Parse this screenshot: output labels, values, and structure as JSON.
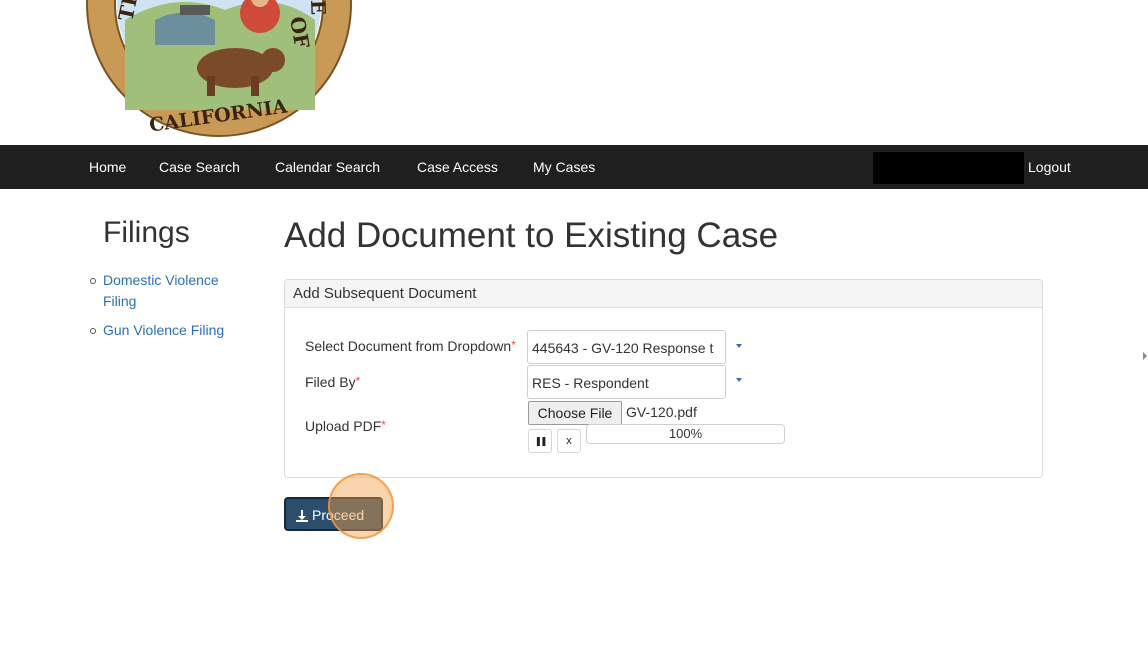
{
  "seal": {
    "text_left": "THE",
    "text_bottom": "CALIFORNIA",
    "text_right": "OF",
    "text_top_right": "E"
  },
  "nav": {
    "items": [
      {
        "label": "Home"
      },
      {
        "label": "Case Search"
      },
      {
        "label": "Calendar Search"
      },
      {
        "label": "Case Access"
      },
      {
        "label": "My Cases"
      }
    ],
    "logout_label": "Logout"
  },
  "sidebar": {
    "title": "Filings",
    "items": [
      {
        "label": "Domestic Violence Filing"
      },
      {
        "label": "Gun Violence Filing"
      }
    ]
  },
  "main": {
    "title": "Add Document to Existing Case",
    "panel_title": "Add Subsequent Document",
    "form": {
      "document_label": "Select Document from Dropdown",
      "document_value": "445643 - GV-120 Response t",
      "filed_by_label": "Filed By",
      "filed_by_value": "RES - Respondent",
      "upload_label": "Upload PDF",
      "required_mark": "*",
      "choose_file_label": "Choose File",
      "file_name": "GV-120.pdf",
      "pause_symbol": "❚❚",
      "cancel_symbol": "x",
      "progress": 100,
      "progress_text": "100%"
    },
    "proceed_label": "Proceed"
  },
  "colors": {
    "navbar": "#1f1f1f",
    "link": "#2a6fb4",
    "proceed": "#2b4d6e",
    "required": "#d9534f",
    "click_highlight": "#f5a046"
  },
  "icons": [
    "download-icon",
    "pause-icon",
    "close-icon",
    "chevron-down-icon"
  ]
}
